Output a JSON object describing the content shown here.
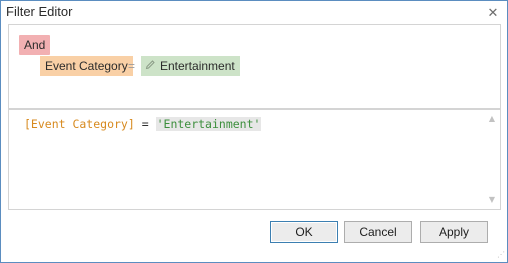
{
  "window": {
    "title": "Filter Editor",
    "close_glyph": "✕"
  },
  "visual_editor": {
    "group_operator": "And",
    "condition": {
      "field": "Event Category",
      "operator": "=",
      "value": "Entertainment",
      "value_icon": "pencil-icon"
    }
  },
  "text_editor": {
    "field_token": "[Event Category]",
    "operator_token": "=",
    "value_token": "'Entertainment'"
  },
  "buttons": {
    "ok": "OK",
    "cancel": "Cancel",
    "apply": "Apply"
  },
  "colors": {
    "group_operator_bg": "#f2b0b2",
    "field_bg": "#f9d0a6",
    "value_bg": "#cde3c8",
    "field_text": "#d78a1f",
    "string_text": "#3d8f3d",
    "accent_border": "#3c7fb1"
  }
}
